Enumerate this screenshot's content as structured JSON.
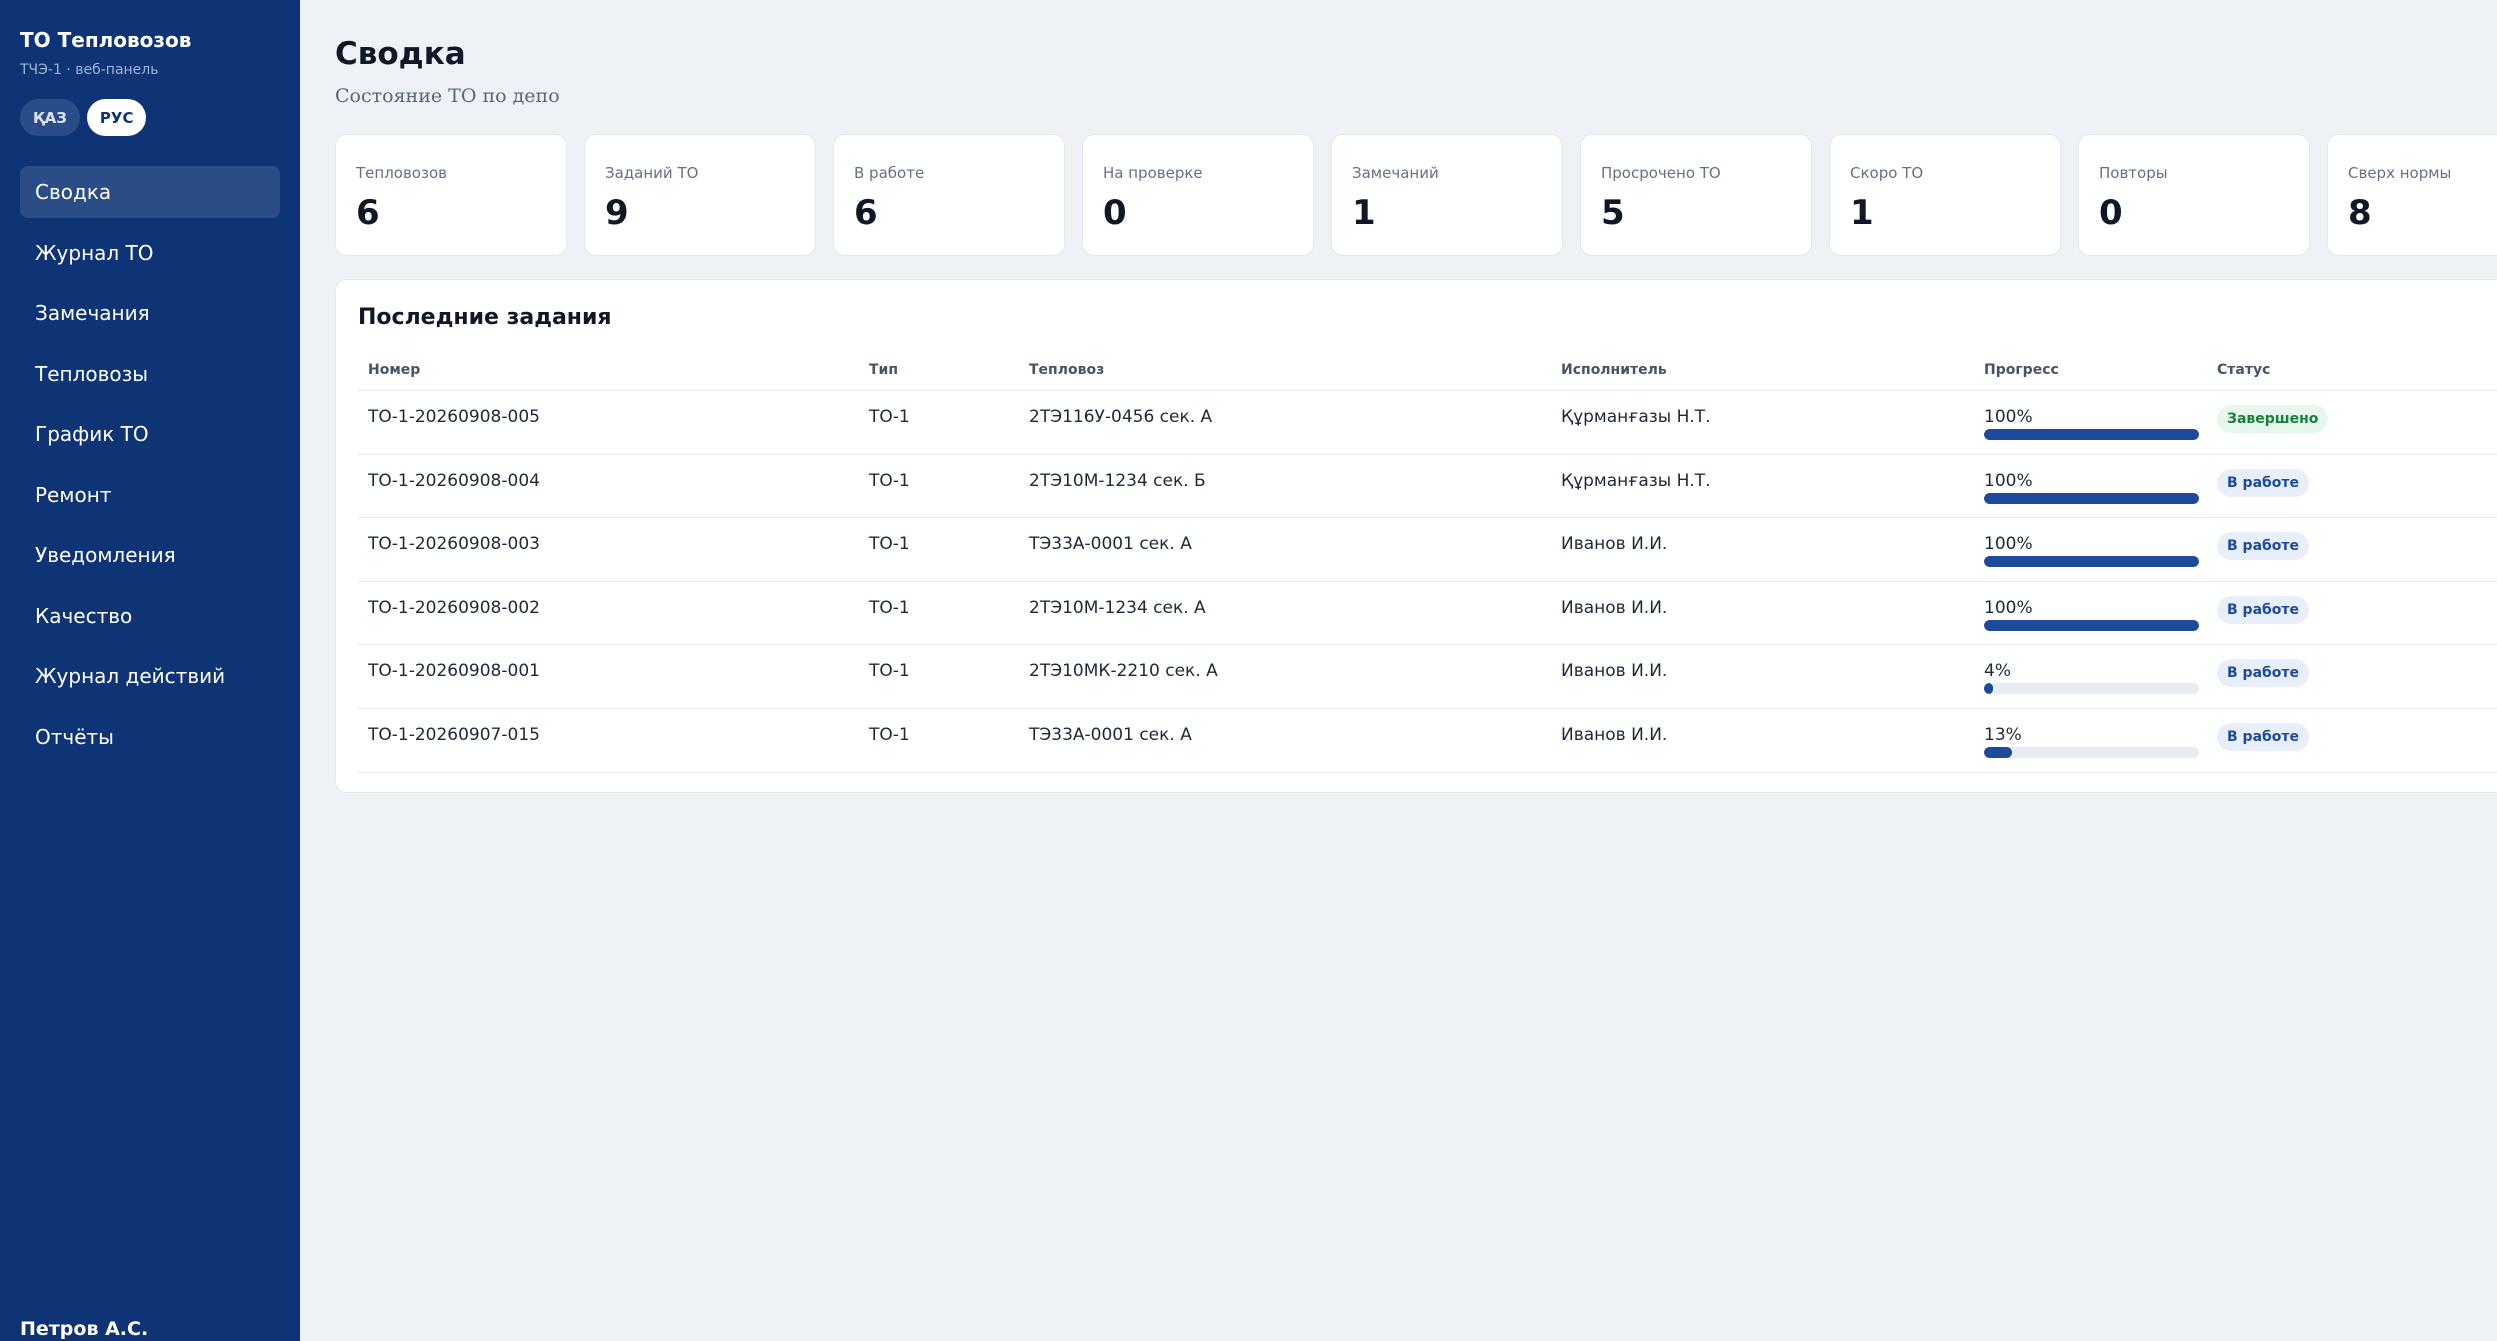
{
  "sidebar": {
    "brand_title": "ТО Тепловозов",
    "brand_sub": "ТЧЭ-1 · веб-панель",
    "lang": {
      "kaz": "ҚАЗ",
      "rus": "РУС",
      "active": "rus"
    },
    "items": [
      {
        "label": "Сводка",
        "active": true
      },
      {
        "label": "Журнал ТО"
      },
      {
        "label": "Замечания"
      },
      {
        "label": "Тепловозы"
      },
      {
        "label": "График ТО"
      },
      {
        "label": "Ремонт"
      },
      {
        "label": "Уведомления"
      },
      {
        "label": "Качество"
      },
      {
        "label": "Журнал действий"
      },
      {
        "label": "Отчёты"
      }
    ],
    "user": "Петров А.С."
  },
  "header": {
    "title": "Сводка",
    "subtitle": "Состояние ТО по депо"
  },
  "stats": [
    {
      "label": "Тепловозов",
      "value": "6"
    },
    {
      "label": "Заданий ТО",
      "value": "9"
    },
    {
      "label": "В работе",
      "value": "6"
    },
    {
      "label": "На проверке",
      "value": "0"
    },
    {
      "label": "Замечаний",
      "value": "1"
    },
    {
      "label": "Просрочено ТО",
      "value": "5"
    },
    {
      "label": "Скоро ТО",
      "value": "1"
    },
    {
      "label": "Повторы",
      "value": "0"
    },
    {
      "label": "Сверх нормы",
      "value": "8"
    }
  ],
  "tasks": {
    "title": "Последние задания",
    "columns": {
      "num": "Номер",
      "type": "Тип",
      "loco": "Тепловоз",
      "exec": "Исполнитель",
      "prog": "Прогресс",
      "stat": "Статус"
    },
    "rows": [
      {
        "num": "ТО-1-20260908-005",
        "type": "ТО-1",
        "loco": "2ТЭ116У-0456 сек. А",
        "exec": "Құрманғазы Н.Т.",
        "progress": "100%",
        "progress_value": 100,
        "status": "Завершено",
        "status_kind": "done"
      },
      {
        "num": "ТО-1-20260908-004",
        "type": "ТО-1",
        "loco": "2ТЭ10М-1234 сек. Б",
        "exec": "Құрманғазы Н.Т.",
        "progress": "100%",
        "progress_value": 100,
        "status": "В работе",
        "status_kind": "work"
      },
      {
        "num": "ТО-1-20260908-003",
        "type": "ТО-1",
        "loco": "ТЭ33А-0001 сек. А",
        "exec": "Иванов И.И.",
        "progress": "100%",
        "progress_value": 100,
        "status": "В работе",
        "status_kind": "work"
      },
      {
        "num": "ТО-1-20260908-002",
        "type": "ТО-1",
        "loco": "2ТЭ10М-1234 сек. А",
        "exec": "Иванов И.И.",
        "progress": "100%",
        "progress_value": 100,
        "status": "В работе",
        "status_kind": "work"
      },
      {
        "num": "ТО-1-20260908-001",
        "type": "ТО-1",
        "loco": "2ТЭ10МК-2210 сек. А",
        "exec": "Иванов И.И.",
        "progress": "4%",
        "progress_value": 4,
        "status": "В работе",
        "status_kind": "work"
      },
      {
        "num": "ТО-1-20260907-015",
        "type": "ТО-1",
        "loco": "ТЭ33А-0001 сек. А",
        "exec": "Иванов И.И.",
        "progress": "13%",
        "progress_value": 13,
        "status": "В работе",
        "status_kind": "work"
      }
    ]
  },
  "colors": {
    "sidebar_bg": "#0e3475",
    "accent": "#1e4a9b",
    "done_green": "#16803c",
    "page_bg": "#eef1f6"
  }
}
